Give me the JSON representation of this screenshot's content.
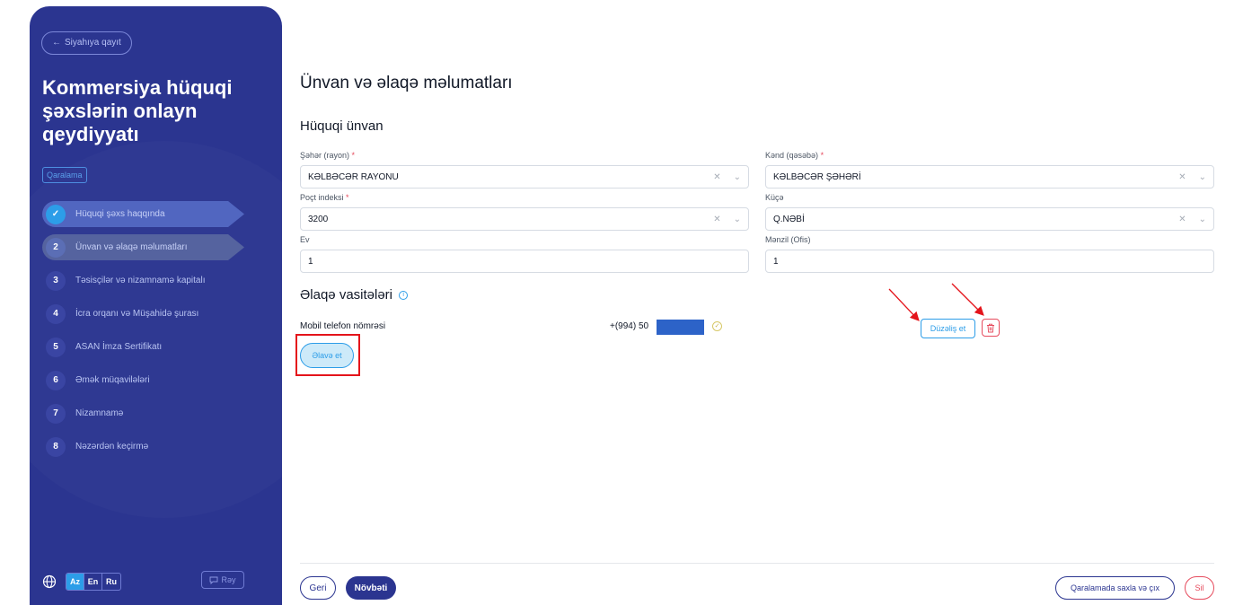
{
  "sidebar": {
    "back_label": "Siyahıya qayıt",
    "title": "Kommersiya hüquqi şəxslərin onlayn qeydiyyatı",
    "draft_badge": "Qaralama",
    "steps": [
      {
        "num": "✓",
        "label": "Hüquqi şəxs haqqında",
        "state": "done"
      },
      {
        "num": "2",
        "label": "Ünvan və əlaqə məlumatları",
        "state": "current"
      },
      {
        "num": "3",
        "label": "Təsisçilər və nizamnamə kapitalı",
        "state": "pending"
      },
      {
        "num": "4",
        "label": "İcra orqanı və Müşahidə şurası",
        "state": "pending"
      },
      {
        "num": "5",
        "label": "ASAN İmza Sertifikatı",
        "state": "pending"
      },
      {
        "num": "6",
        "label": "Əmək müqavilələri",
        "state": "pending"
      },
      {
        "num": "7",
        "label": "Nizamnamə",
        "state": "pending"
      },
      {
        "num": "8",
        "label": "Nəzərdən keçirmə",
        "state": "pending"
      }
    ],
    "languages": [
      "Az",
      "En",
      "Ru"
    ],
    "active_language": "Az",
    "feedback_label": "Rəy"
  },
  "main": {
    "page_title": "Ünvan və əlaqə məlumatları",
    "legal_address_title": "Hüquqi ünvan",
    "fields": {
      "city": {
        "label": "Şəhər (rayon)",
        "required": true,
        "value": "KƏLBƏCƏR RAYONU",
        "type": "select"
      },
      "village": {
        "label": "Kənd (qəsəbə)",
        "required": true,
        "value": "KƏLBƏCƏR ŞƏHƏRİ",
        "type": "select"
      },
      "postal": {
        "label": "Poçt indeksi",
        "required": true,
        "value": "3200",
        "type": "select"
      },
      "street": {
        "label": "Küçə",
        "required": false,
        "value": "Q.NƏBİ",
        "type": "select"
      },
      "house": {
        "label": "Ev",
        "required": false,
        "value": "1",
        "type": "text"
      },
      "apartment": {
        "label": "Mənzil (Ofis)",
        "required": false,
        "value": "1",
        "type": "text"
      }
    },
    "contact_title": "Əlaqə vasitələri",
    "contact": {
      "label": "Mobil telefon nömrəsi",
      "value": "+(994) 50",
      "edit_label": "Düzəliş et"
    },
    "add_label": "Əlavə et",
    "footer": {
      "back_label": "Geri",
      "next_label": "Növbəti",
      "save_draft_label": "Qaralamada saxla və çıx",
      "delete_label": "Sil"
    }
  },
  "colors": {
    "sidebar_bg": "#2b3590",
    "accent": "#2c9de8",
    "danger": "#e64b5d",
    "annotation": "#e4141b"
  }
}
